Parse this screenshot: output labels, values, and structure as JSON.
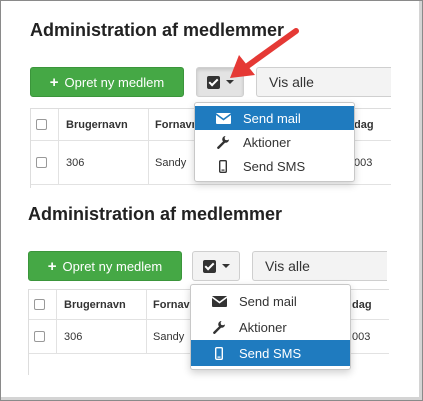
{
  "panels": [
    {
      "title": "Administration af medlemmer",
      "new_member_button": "Opret ny medlem",
      "filter_value": "Vis alle",
      "table": {
        "headers": [
          "Brugernavn",
          "Fornavn",
          "dag"
        ],
        "row": [
          "306",
          "Sandy",
          "003"
        ]
      },
      "dropdown": [
        {
          "label": "Send mail",
          "icon": "envelope-icon",
          "active": true
        },
        {
          "label": "Aktioner",
          "icon": "wrench-icon",
          "active": false
        },
        {
          "label": "Send SMS",
          "icon": "mobile-phone-icon",
          "active": false
        }
      ]
    },
    {
      "title": "Administration af medlemmer",
      "new_member_button": "Opret ny medlem",
      "filter_value": "Vis alle",
      "table": {
        "headers": [
          "Brugernavn",
          "Fornavn",
          "dag"
        ],
        "row": [
          "306",
          "Sandy",
          "003"
        ]
      },
      "dropdown": [
        {
          "label": "Send mail",
          "icon": "envelope-icon",
          "active": false
        },
        {
          "label": "Aktioner",
          "icon": "wrench-icon",
          "active": false
        },
        {
          "label": "Send SMS",
          "icon": "mobile-phone-icon",
          "active": true
        }
      ]
    }
  ],
  "colors": {
    "green_button": "#45a845",
    "menu_highlight": "#1f7bbf",
    "annotation_arrow": "#e53935"
  }
}
